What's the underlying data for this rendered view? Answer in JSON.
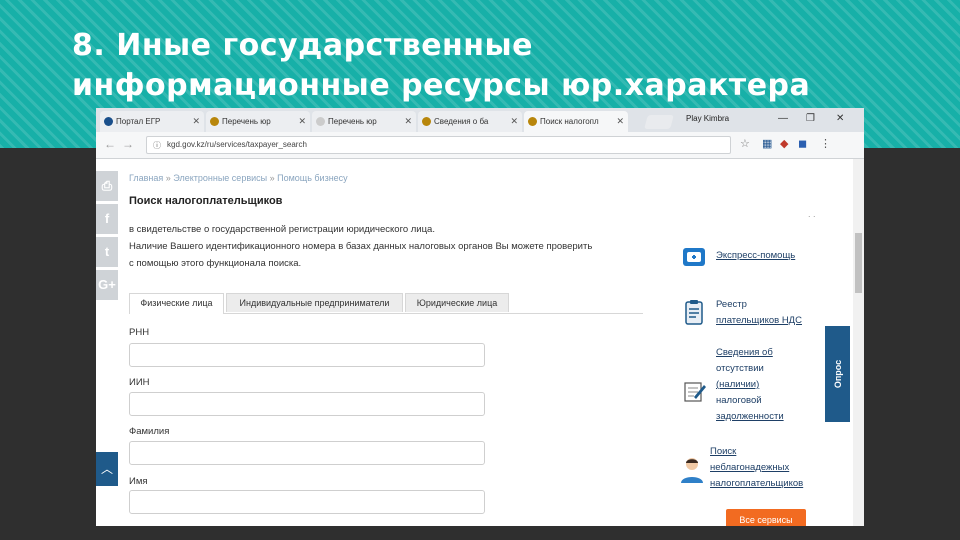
{
  "slide": {
    "title_line1": "8. Иные государственные",
    "title_line2": "информационные ресурсы юр.характера"
  },
  "browser": {
    "tabs": [
      {
        "label": "Портал ЕГР",
        "active": false,
        "fav": "#1a4f8b"
      },
      {
        "label": "Перечень юр",
        "active": false,
        "fav": "#b8860b"
      },
      {
        "label": "Перечень юр",
        "active": false,
        "fav": "#cccccc"
      },
      {
        "label": "Сведения о ба",
        "active": false,
        "fav": "#b8860b"
      },
      {
        "label": "Поиск налогопл",
        "active": true,
        "fav": "#b8860b"
      }
    ],
    "profile_label": "Play Kimbra",
    "url": "kgd.gov.kz/ru/services/taxpayer_search"
  },
  "page": {
    "breadcrumb": [
      "Главная",
      "Электронные сервисы",
      "Помощь бизнесу"
    ],
    "title": "Поиск налогоплательщиков",
    "intro_lines": [
      "в свидетельстве о государственной регистрации юридического лица.",
      "Наличие Вашего идентификационного номера в базах данных налоговых органов Вы можете проверить",
      "с помощью этого функционала поиска."
    ],
    "tabs": [
      "Физические лица",
      "Индивидуальные предприниматели",
      "Юридические лица"
    ],
    "fields": [
      {
        "label": "РНН",
        "value": ""
      },
      {
        "label": "ИИН",
        "value": ""
      },
      {
        "label": "Фамилия",
        "value": ""
      },
      {
        "label": "Имя",
        "value": ""
      }
    ]
  },
  "sidebar": {
    "express_help": "Экспресс-помощь",
    "registry": [
      "Реестр",
      "плательщиков НДС"
    ],
    "debt_info": [
      "Сведения об",
      "отсутствии",
      "(наличии)",
      "налоговой",
      "задолженности"
    ],
    "unreliable": [
      "Поиск",
      "неблагонадежных",
      "налогоплательщиков"
    ],
    "all_services": "Все сервисы",
    "survey": "Опрос"
  },
  "icons": {
    "share": [
      "print-icon",
      "facebook-icon",
      "twitter-icon",
      "google-plus-icon"
    ],
    "colors": {
      "accent": "#1f5a8a",
      "orange": "#f26b21",
      "teal": "#17b0a8"
    }
  }
}
